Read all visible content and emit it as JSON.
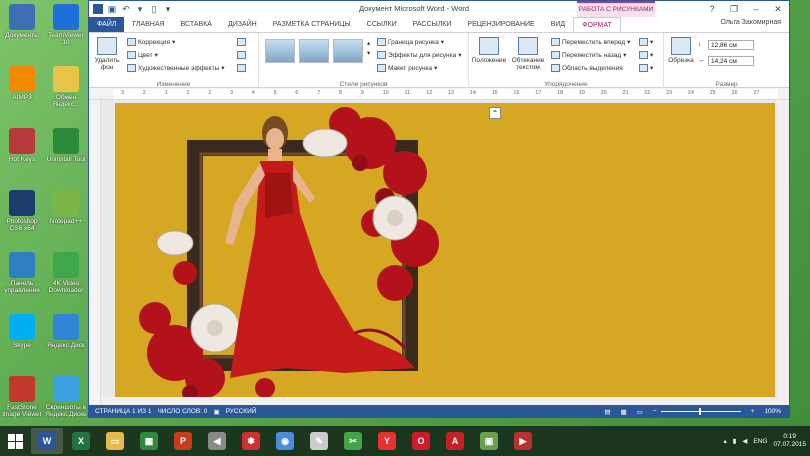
{
  "window": {
    "doc_title": "Документ Microsoft Word - Word",
    "context_tab_group": "РАБОТА С РИСУНКАМИ",
    "user": "Ольга Закомирная",
    "controls": [
      "?",
      "–",
      "❐",
      "✕"
    ]
  },
  "desktop_icons": [
    {
      "label": "Документы",
      "color": "#3d6fb5"
    },
    {
      "label": "TeamViewer 10",
      "color": "#1e6fd9"
    },
    {
      "label": "AIMP3",
      "color": "#f08a00"
    },
    {
      "label": "Обмен Яндекс...",
      "color": "#e8c44a"
    },
    {
      "label": "Hot Keys",
      "color": "#b93a3a"
    },
    {
      "label": "Uninstall Tool",
      "color": "#2d8a3d"
    },
    {
      "label": "Photoshop CS6 x64",
      "color": "#1b3d6e"
    },
    {
      "label": "Notepad++",
      "color": "#7ab648"
    },
    {
      "label": "Панель управления",
      "color": "#2d7fc1"
    },
    {
      "label": "4K Video Downloader",
      "color": "#3fa64a"
    },
    {
      "label": "Skype",
      "color": "#00aff0"
    },
    {
      "label": "Яндекс.Диск",
      "color": "#2f86d6"
    },
    {
      "label": "FastStone Image Viewer",
      "color": "#c0392b"
    },
    {
      "label": "Скриншоты в Яндекс.Диске",
      "color": "#3aa0e0"
    }
  ],
  "tabs": [
    {
      "label": "ФАЙЛ",
      "kind": "file"
    },
    {
      "label": "ГЛАВНАЯ",
      "kind": "normal"
    },
    {
      "label": "ВСТАВКА",
      "kind": "normal"
    },
    {
      "label": "ДИЗАЙН",
      "kind": "normal"
    },
    {
      "label": "РАЗМЕТКА СТРАНИЦЫ",
      "kind": "normal"
    },
    {
      "label": "ССЫЛКИ",
      "kind": "normal"
    },
    {
      "label": "РАССЫЛКИ",
      "kind": "normal"
    },
    {
      "label": "РЕЦЕНЗИРОВАНИЕ",
      "kind": "normal"
    },
    {
      "label": "ВИД",
      "kind": "normal"
    },
    {
      "label": "ФОРМАТ",
      "kind": "format"
    }
  ],
  "ribbon": {
    "remove_bg": "Удалить фон",
    "correction": "Коррекция",
    "color": "Цвет",
    "art_effects": "Художественные эффекты",
    "group_change": "Изменение",
    "picture_border": "Граница рисунка",
    "picture_effects": "Эффекты для рисунка",
    "picture_layout": "Макет рисунка",
    "group_styles": "Стили рисунков",
    "position": "Положение",
    "wrap_text": "Обтекание текстом",
    "bring_forward": "Переместить вперед",
    "send_backward": "Переместить назад",
    "selection_pane": "Область выделения",
    "group_arrange": "Упорядочение",
    "crop": "Обрезка",
    "height": "12,86 см",
    "width": "14,24 см",
    "group_size": "Размер"
  },
  "ruler_ticks": [
    "3",
    "2",
    "1",
    "1",
    "2",
    "3",
    "4",
    "5",
    "6",
    "7",
    "8",
    "9",
    "10",
    "11",
    "12",
    "13",
    "14",
    "15",
    "16",
    "17",
    "18",
    "19",
    "20",
    "21",
    "22",
    "23",
    "24",
    "25",
    "26",
    "27"
  ],
  "statusbar": {
    "page": "СТРАНИЦА 1 ИЗ 1",
    "words": "ЧИСЛО СЛОВ: 0",
    "lang": "РУССКИЙ",
    "zoom": "100%"
  },
  "taskbar": {
    "apps": [
      {
        "name": "word",
        "glyph": "W",
        "color": "#2b579a",
        "active": true
      },
      {
        "name": "excel",
        "glyph": "X",
        "color": "#217346",
        "active": false
      },
      {
        "name": "explorer",
        "glyph": "▭",
        "color": "#e8b84a",
        "active": false
      },
      {
        "name": "project",
        "glyph": "▦",
        "color": "#2e8a3e",
        "active": false
      },
      {
        "name": "powerpoint",
        "glyph": "P",
        "color": "#c43e1c",
        "active": false
      },
      {
        "name": "media",
        "glyph": "◀",
        "color": "#8a8a8a",
        "active": false
      },
      {
        "name": "game",
        "glyph": "✽",
        "color": "#d03030",
        "active": false
      },
      {
        "name": "chrome",
        "glyph": "◉",
        "color": "#4a8cd9",
        "active": false
      },
      {
        "name": "notepad",
        "glyph": "✎",
        "color": "#cccccc",
        "active": false
      },
      {
        "name": "clipper",
        "glyph": "✂",
        "color": "#3fa64a",
        "active": false
      },
      {
        "name": "yandex",
        "glyph": "Y",
        "color": "#e83030",
        "active": false
      },
      {
        "name": "opera",
        "glyph": "O",
        "color": "#d01a2a",
        "active": false
      },
      {
        "name": "pdf",
        "glyph": "A",
        "color": "#c22222",
        "active": false
      },
      {
        "name": "photos",
        "glyph": "▣",
        "color": "#6aa050",
        "active": false
      },
      {
        "name": "player",
        "glyph": "▶",
        "color": "#b83030",
        "active": false
      }
    ],
    "lang": "ENG",
    "time": "0:19",
    "date": "07.07.2015"
  }
}
